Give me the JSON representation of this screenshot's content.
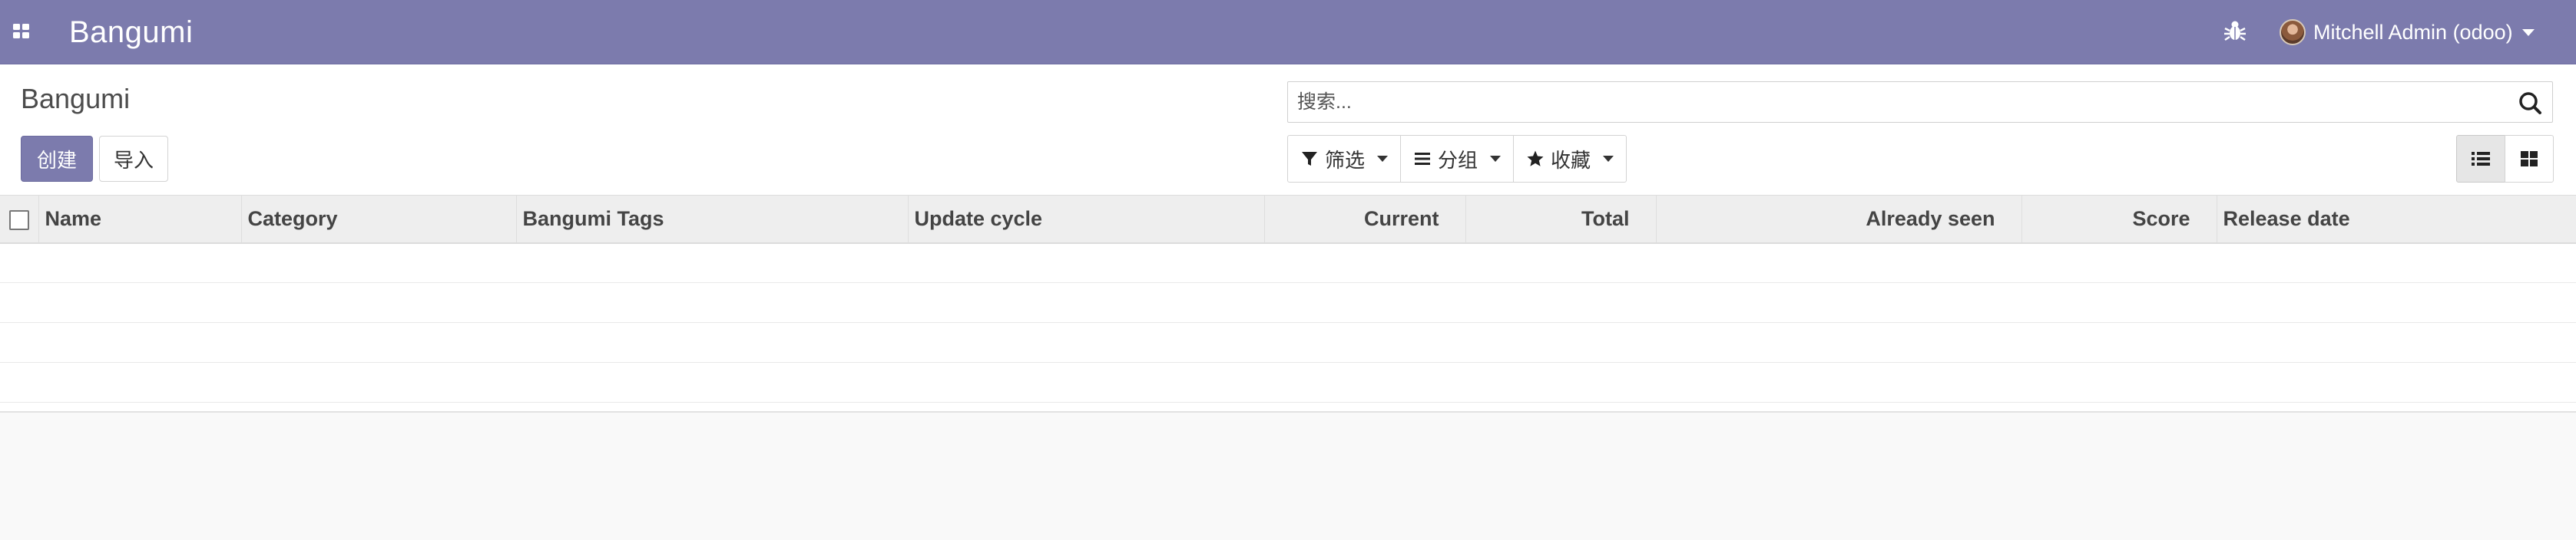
{
  "navbar": {
    "apps_icon": "apps-grid-icon",
    "app_title": "Bangumi",
    "debug_icon": "bug-icon",
    "user_name": "Mitchell Admin (odoo)"
  },
  "control_panel": {
    "breadcrumb": "Bangumi",
    "create_label": "创建",
    "import_label": "导入",
    "search": {
      "placeholder": "搜索...",
      "value": ""
    },
    "filters_label": "筛选",
    "group_by_label": "分组",
    "favorites_label": "收藏",
    "views": [
      {
        "name": "list-view-icon",
        "active": true
      },
      {
        "name": "kanban-view-icon",
        "active": false
      }
    ]
  },
  "table": {
    "columns": [
      "Name",
      "Category",
      "Bangumi Tags",
      "Update cycle",
      "Current",
      "Total",
      "Already seen",
      "Score",
      "Release date"
    ],
    "rows": []
  },
  "colors": {
    "navbar_bg": "#7c7bad",
    "primary_button": "#7c7bad",
    "page_bg": "#f9f9f9"
  }
}
